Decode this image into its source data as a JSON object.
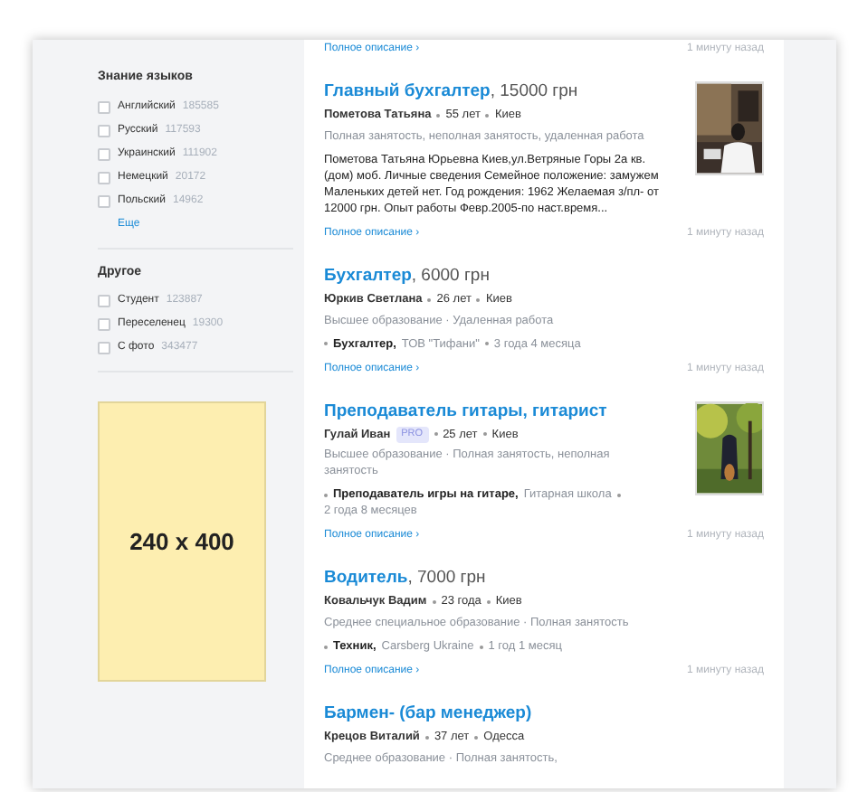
{
  "sidebar": {
    "filter_groups": [
      {
        "title": "Знание языков",
        "options": [
          {
            "label": "Английский",
            "count": "185585",
            "checked": false
          },
          {
            "label": "Русский",
            "count": "117593",
            "checked": false
          },
          {
            "label": "Украинский",
            "count": "111902",
            "checked": false
          },
          {
            "label": "Немецкий",
            "count": "20172",
            "checked": false
          },
          {
            "label": "Польский",
            "count": "14962",
            "checked": false
          }
        ],
        "more_link": "Еще"
      },
      {
        "title": "Другое",
        "options": [
          {
            "label": "Студент",
            "count": "123887",
            "checked": false
          },
          {
            "label": "Переселенец",
            "count": "19300",
            "checked": false
          },
          {
            "label": "С фото",
            "count": "343477",
            "checked": false
          }
        ]
      }
    ],
    "ad_placeholder": "240 x 400"
  },
  "results": [
    {
      "kind": "tail",
      "link": "Полное описание ›",
      "time": "1 минуту назад"
    },
    {
      "kind": "resume",
      "title": "Главный бухгалтер",
      "salary": ", 15000 грн",
      "name": "Пометова Татьяна",
      "age": "55 лет",
      "city": "Киев",
      "details": "Полная занятость, неполная занятость, удаленная работа",
      "description": "Пометова Татьяна Юрьевна Киев,ул.Ветряные Горы 2а кв.(дом) моб. Личные сведения Семейное положение: замужем Маленьких детей нет. Год рождения: 1962 Желаемая з/пл- от 12000 грн. Опыт работы Февр.2005-по наст.время...",
      "photo": true,
      "link": "Полное описание ›",
      "time": "1 минуту назад"
    },
    {
      "kind": "resume",
      "title": "Бухгалтер",
      "salary": ", 6000 грн",
      "name": "Юркив Светлана",
      "age": "26 лет",
      "city": "Киев",
      "details": "Высшее образование · Удаленная работа",
      "experience": {
        "position": "Бухгалтер,",
        "company": "ТОВ \"Тифани\"",
        "duration": "3 года 4 месяца"
      },
      "link": "Полное описание ›",
      "time": "1 минуту назад"
    },
    {
      "kind": "resume",
      "title": "Преподаватель гитары, гитарист",
      "name": "Гулай Иван",
      "pro": "PRO",
      "age": "25 лет",
      "city": "Киев",
      "details": "Высшее образование · Полная занятость, неполная занятость",
      "experience": {
        "position": "Преподаватель игры на гитаре,",
        "company": "Гитарная школа",
        "duration": "2 года 8 месяцев"
      },
      "photo": true,
      "link": "Полное описание ›",
      "time": "1 минуту назад"
    },
    {
      "kind": "resume",
      "title": "Водитель",
      "salary": ", 7000 грн",
      "name": "Ковальчук Вадим",
      "age": "23 года",
      "city": "Киев",
      "details": "Среднее специальное образование · Полная занятость",
      "experience": {
        "position": "Техник,",
        "company": "Carsberg Ukraine",
        "duration": "1 год 1 месяц"
      },
      "link": "Полное описание ›",
      "time": "1 минуту назад"
    },
    {
      "kind": "resume",
      "title": "Бармен- (бар менеджер)",
      "name": "Крецов Виталий",
      "age": "37 лет",
      "city": "Одесса",
      "details": "Среднее образование · Полная занятость,"
    }
  ]
}
